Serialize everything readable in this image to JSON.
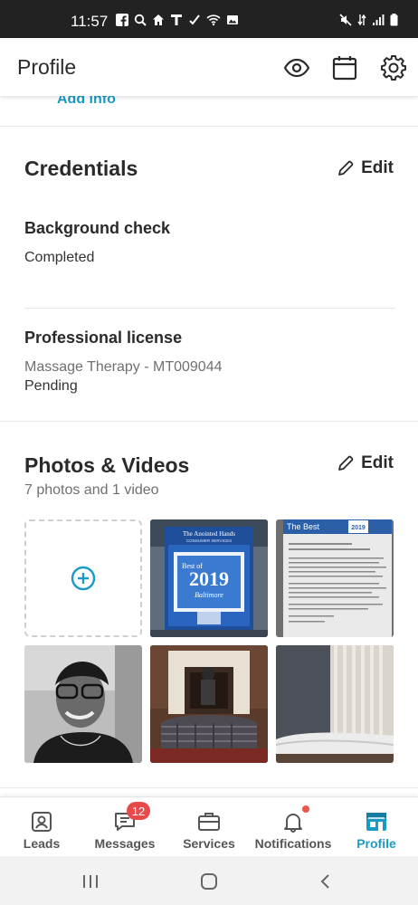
{
  "status_bar": {
    "time": "11:57"
  },
  "header": {
    "title": "Profile",
    "icons": [
      "eye-icon",
      "calendar-icon",
      "gear-icon"
    ]
  },
  "add_info_label": "Add info",
  "credentials": {
    "title": "Credentials",
    "edit_label": "Edit",
    "background_check": {
      "title": "Background check",
      "status": "Completed"
    },
    "professional_license": {
      "title": "Professional license",
      "detail": "Massage Therapy - MT009044",
      "status": "Pending"
    }
  },
  "photos": {
    "title": "Photos & Videos",
    "edit_label": "Edit",
    "count_text": "7 photos and 1 video",
    "thumb_award": {
      "heading": "The Anointed Hands",
      "subheading": "CONSUMER SERVICES",
      "best_of": "Best of",
      "year": "2019",
      "city": "Baltimore"
    },
    "thumb_letter": {
      "heading": "The Best",
      "year": "2019"
    }
  },
  "bottom_nav": {
    "items": [
      {
        "label": "Leads",
        "icon": "person-icon"
      },
      {
        "label": "Messages",
        "icon": "chat-icon",
        "badge": "12"
      },
      {
        "label": "Services",
        "icon": "briefcase-icon"
      },
      {
        "label": "Notifications",
        "icon": "bell-icon"
      },
      {
        "label": "Profile",
        "icon": "storefront-icon"
      }
    ],
    "active_color": "#1a9bc6"
  },
  "colors": {
    "accent": "#1a9bc6",
    "badge": "#e8494b",
    "text": "#2a2a2a"
  }
}
